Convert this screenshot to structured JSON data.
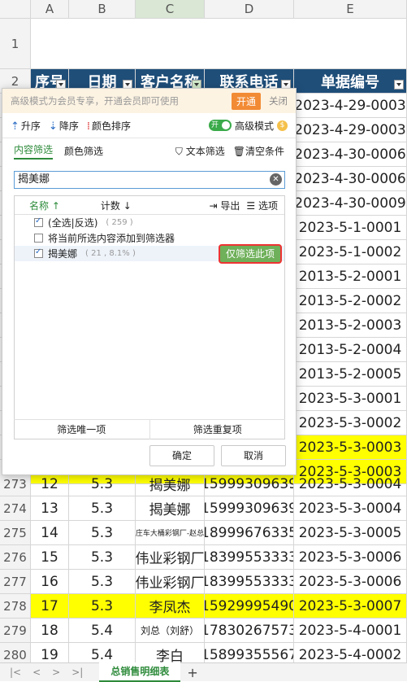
{
  "columns": [
    "A",
    "B",
    "C",
    "D",
    "E"
  ],
  "header_row": {
    "num": "2",
    "a": "序号",
    "b": "日期",
    "c": "客户名称",
    "d": "联系电话",
    "e": "单据编号"
  },
  "row1_num": "1",
  "side_rows": [
    {
      "num": "",
      "e": "2023-4-29-0003"
    },
    {
      "num": "",
      "e": "2023-4-29-0003"
    },
    {
      "num": "",
      "e": "2023-4-30-0006"
    },
    {
      "num": "",
      "e": "2023-4-30-0006"
    },
    {
      "num": "",
      "e": "2023-4-30-0009"
    },
    {
      "num": "",
      "e": "2023-5-1-0001"
    },
    {
      "num": "",
      "e": "2023-5-1-0002"
    },
    {
      "num": "",
      "e": "2013-5-2-0001"
    },
    {
      "num": "",
      "e": "2013-5-2-0002"
    },
    {
      "num": "",
      "e": "2013-5-2-0003"
    },
    {
      "num": "",
      "e": "2013-5-2-0004"
    },
    {
      "num": "",
      "e": "2013-5-2-0005"
    },
    {
      "num": "",
      "e": "2023-5-3-0001"
    },
    {
      "num": "",
      "e": "2023-5-3-0002"
    },
    {
      "num": "",
      "e": "2023-5-3-0003"
    },
    {
      "num": "",
      "e": "2023-5-3-0003"
    }
  ],
  "rows": [
    {
      "num": "273",
      "a": "12",
      "b": "5.3",
      "c": "揭美娜",
      "d": "15999309639",
      "e": "2023-5-3-0004"
    },
    {
      "num": "274",
      "a": "13",
      "b": "5.3",
      "c": "揭美娜",
      "d": "15999309639",
      "e": "2023-5-3-0004"
    },
    {
      "num": "275",
      "a": "14",
      "b": "5.3",
      "c": "庄车大桶彩钢厂-赵总",
      "d": "18999676335",
      "e": "2023-5-3-0005"
    },
    {
      "num": "276",
      "a": "15",
      "b": "5.3",
      "c": "伟业彩钢厂",
      "d": "18399553333",
      "e": "2023-5-3-0006"
    },
    {
      "num": "277",
      "a": "16",
      "b": "5.3",
      "c": "伟业彩钢厂",
      "d": "18399553333",
      "e": "2023-5-3-0006"
    },
    {
      "num": "278",
      "a": "17",
      "b": "5.3",
      "c": "李凤杰",
      "d": "15929995490",
      "e": "2023-5-3-0007"
    },
    {
      "num": "279",
      "a": "18",
      "b": "5.4",
      "c": "刘总（刘舒）",
      "d": "17830267573",
      "e": "2023-5-4-0001"
    },
    {
      "num": "280",
      "a": "19",
      "b": "5.4",
      "c": "李白",
      "d": "15899355567",
      "e": "2023-5-4-0002"
    }
  ],
  "dialog": {
    "promo_text": "高级模式为会员专享，开通会员即可使用",
    "open_label": "开通",
    "close_label": "关闭",
    "sort_asc": "升序",
    "sort_desc": "降序",
    "color_sort": "颜色排序",
    "switch_text": "开",
    "advanced_mode": "高级模式",
    "tab_content": "内容筛选",
    "tab_color": "颜色筛选",
    "text_filter": "文本筛选",
    "clear_conditions": "清空条件",
    "search_value": "揭美娜",
    "list_name_header": "名称",
    "list_count_header": "计数",
    "export_label": "导出",
    "options_label": "选项",
    "item_select_all": "(全选|反选)",
    "item_select_all_count": "( 259 )",
    "item_add_to_filter": "将当前所选内容添加到筛选器",
    "item_value": "揭美娜",
    "item_value_count": "( 21 , 8.1% )",
    "only_this_label": "仅筛选此项",
    "unique_label": "筛选唯一项",
    "duplicate_label": "筛选重复项",
    "ok_label": "确定",
    "cancel_label": "取消"
  },
  "sheet_tab": "总销售明细表"
}
